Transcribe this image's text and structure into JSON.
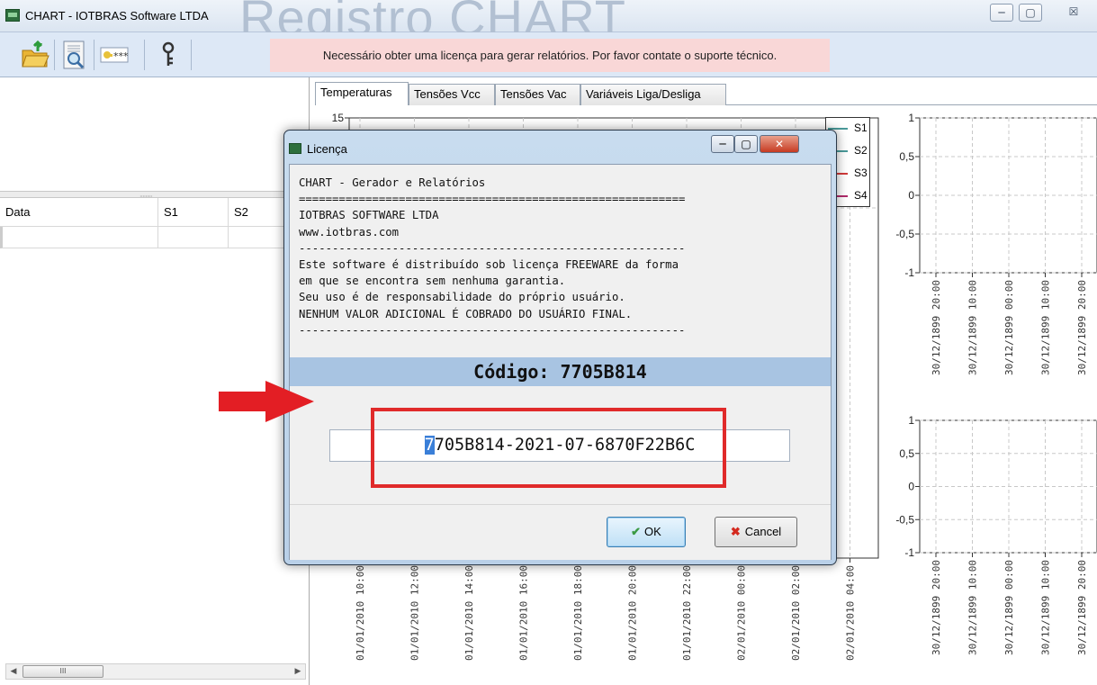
{
  "window": {
    "title": "CHART - IOTBRAS Software LTDA",
    "banner_text": "Registro CHART",
    "buttons": {
      "minimize": "─",
      "maximize": "▢",
      "close": "☒"
    }
  },
  "toolbar": {
    "icons": [
      "open-folder-icon",
      "report-preview-icon",
      "password-icon",
      "key-icon"
    ],
    "license_notice": "Necessário obter uma licença para gerar relatórios. Por favor contate o suporte técnico."
  },
  "data_grid": {
    "columns": [
      "Data",
      "S1",
      "S2"
    ],
    "scroll_thumb_label": "III"
  },
  "tabs": [
    {
      "label": "Temperaturas",
      "active": true
    },
    {
      "label": "Tensões Vcc",
      "active": false
    },
    {
      "label": "Tensões Vac",
      "active": false
    },
    {
      "label": "Variáveis Liga/Desliga",
      "active": false
    }
  ],
  "chart_data": [
    {
      "type": "line",
      "y_ticks": [
        "15"
      ],
      "x_ticks": [
        "01/01/2010 10:00",
        "01/01/2010 12:00",
        "01/01/2010 14:00",
        "01/01/2010 16:00",
        "01/01/2010 18:00",
        "01/01/2010 20:00",
        "01/01/2010 22:00",
        "02/01/2010 00:00",
        "02/01/2010 02:00",
        "02/01/2010 04:00"
      ],
      "series": [
        {
          "name": "S1",
          "color": "#4a9a9a",
          "values": []
        },
        {
          "name": "S2",
          "color": "#4a9a9a",
          "values": []
        },
        {
          "name": "S3",
          "color": "#d23a3a",
          "values": []
        },
        {
          "name": "S4",
          "color": "#b02a6a",
          "values": []
        }
      ],
      "legend": "top-right",
      "grid": true
    },
    {
      "type": "line",
      "y_ticks": [
        "1",
        "0,5",
        "0",
        "-0,5",
        "-1"
      ],
      "x_ticks": [
        "30/12/1899 20:00",
        "30/12/1899 10:00",
        "30/12/1899 00:00",
        "30/12/1899 10:00",
        "30/12/1899 20:00"
      ],
      "series": [],
      "grid": true
    },
    {
      "type": "line",
      "y_ticks": [
        "1",
        "0,5",
        "0",
        "-0,5",
        "-1"
      ],
      "x_ticks": [
        "30/12/1899 20:00",
        "30/12/1899 10:00",
        "30/12/1899 00:00",
        "30/12/1899 10:00",
        "30/12/1899 20:00"
      ],
      "series": [],
      "grid": true
    }
  ],
  "dialog": {
    "title": "Licença",
    "buttons": {
      "minimize": "─",
      "maximize": "▢",
      "close": "✕"
    },
    "license_text": "CHART - Gerador e Relatórios\n==========================================================\nIOTBRAS SOFTWARE LTDA\nwww.iotbras.com\n----------------------------------------------------------\nEste software é distribuído sob licença FREEWARE da forma\nem que se encontra sem nenhuma garantia.\nSeu uso é de responsabilidade do próprio usuário.\nNENHUM VALOR ADICIONAL É COBRADO DO USUÁRIO FINAL.\n----------------------------------------------------------",
    "code_label": "Código: 7705B814",
    "key_first_char": "7",
    "key_rest": "705B814-2021-07-6870F22B6C",
    "ok_label": "OK",
    "cancel_label": "Cancel"
  }
}
